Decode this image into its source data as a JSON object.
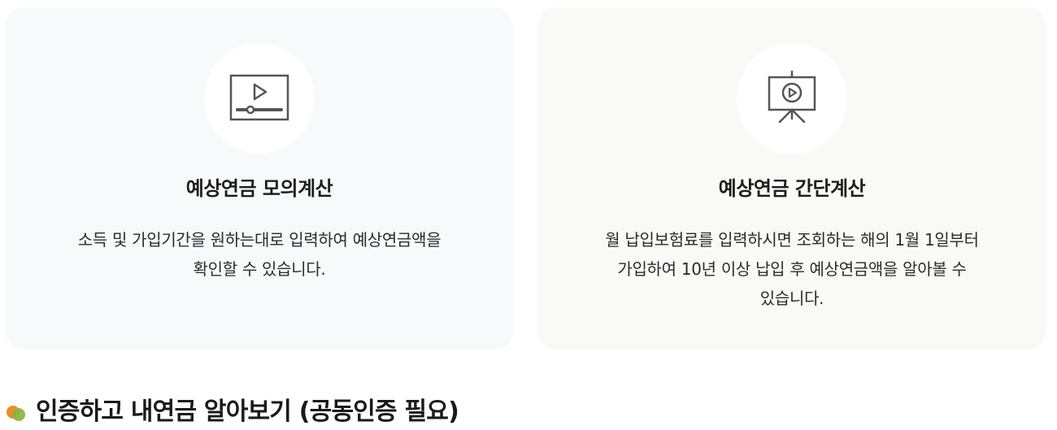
{
  "cards": [
    {
      "icon": "video-player-icon",
      "title": "예상연금 모의계산",
      "description_line1": "소득 및 가입기간을 원하는대로 입력하여 예상연금액을",
      "description_line2": "확인할 수 있습니다."
    },
    {
      "icon": "presentation-video-icon",
      "title": "예상연금 간단계산",
      "description_line1": "월 납입보험료를 입력하시면 조회하는 해의 1월 1일부터",
      "description_line2": "가입하여 10년 이상 납입 후 예상연금액을 알아볼 수",
      "description_line3": "있습니다."
    }
  ],
  "section": {
    "title": "인증하고 내연금 알아보기 (공동인증 필요)"
  },
  "colors": {
    "bullet_orange": "#f08c28",
    "bullet_green": "#8cb43c",
    "icon_stroke": "#555555"
  }
}
